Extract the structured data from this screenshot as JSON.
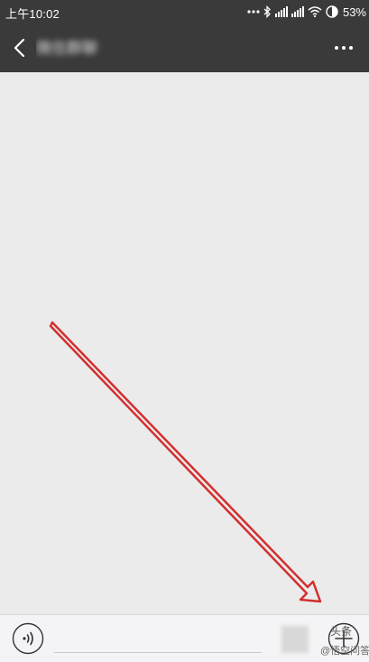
{
  "status_bar": {
    "time": "上午10:02",
    "battery_percent": "53%",
    "icons": [
      "more-dots-icon",
      "bluetooth-icon",
      "signal-icon",
      "signal-icon",
      "wifi-icon",
      "battery-icon"
    ]
  },
  "header": {
    "back_icon": "chevron-left-icon",
    "chat_title": "微信群聊",
    "more_icon": "more-horizontal-icon"
  },
  "colors": {
    "bar_background": "#3a3a3a",
    "chat_background": "#ebebeb",
    "input_bar_background": "#f4f4f6",
    "annotation_arrow": "#d32f2f"
  },
  "input_bar": {
    "voice_icon": "voice-icon",
    "message_value": "",
    "emoji_icon": "emoji-icon",
    "add_icon": "add-circle-icon"
  },
  "watermark": {
    "logo_text": "头条",
    "text": "@悟空问答"
  },
  "annotation": {
    "type": "arrow",
    "color": "#d32f2f"
  }
}
